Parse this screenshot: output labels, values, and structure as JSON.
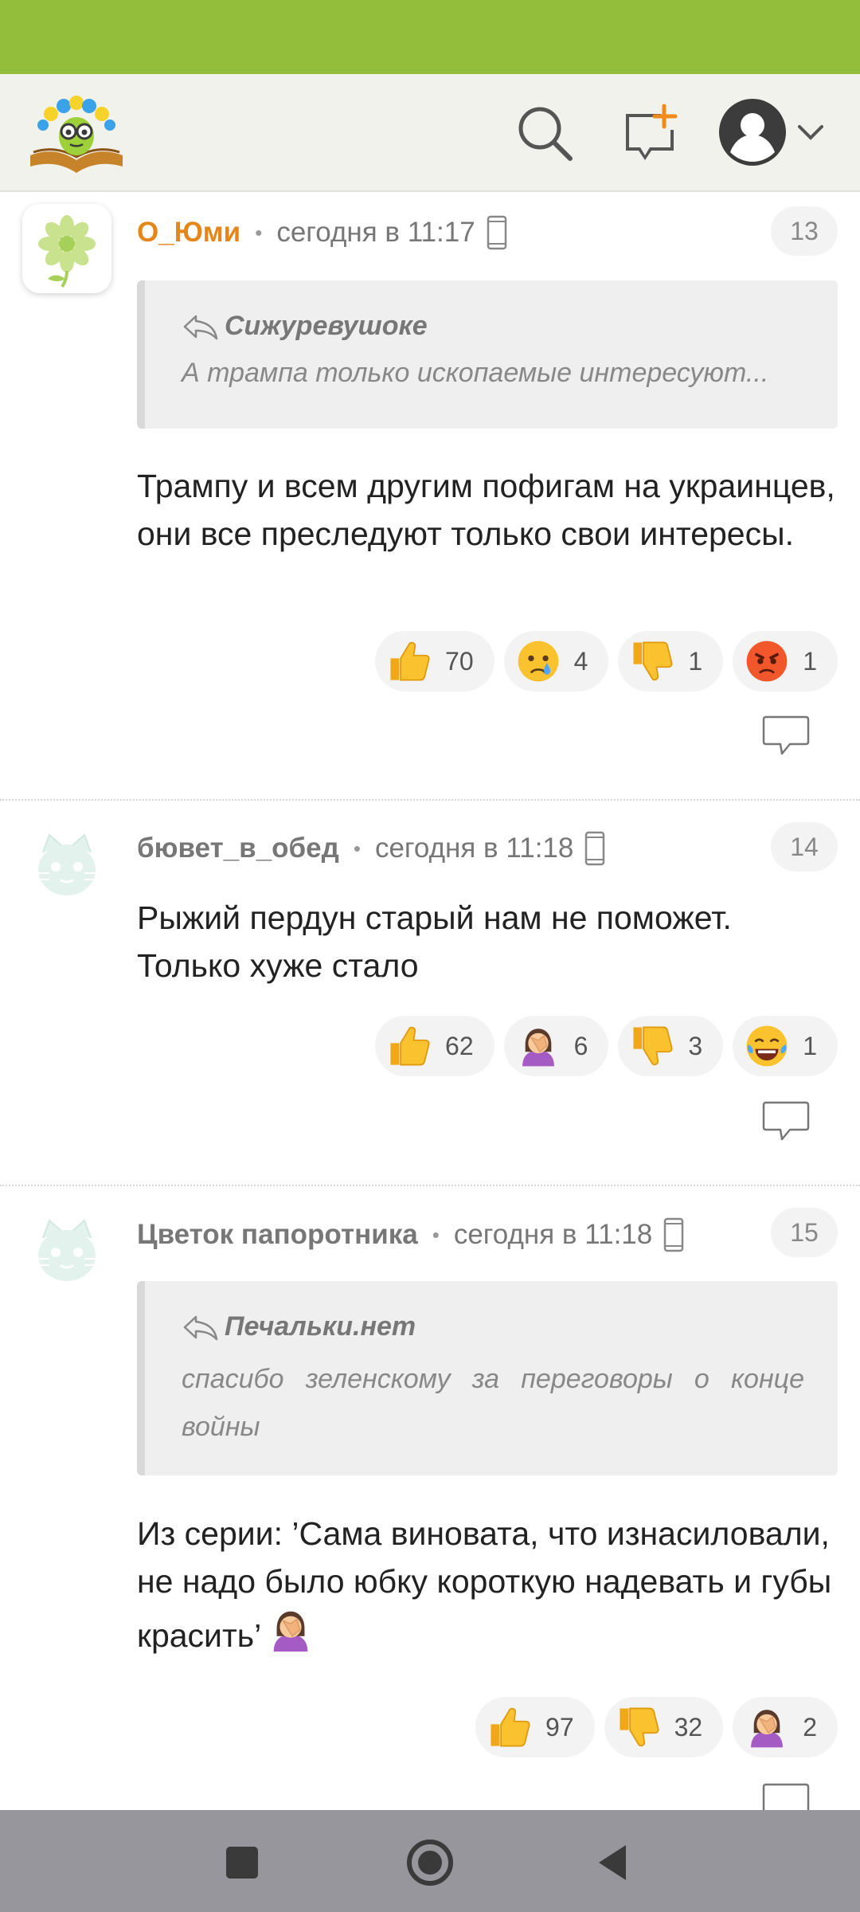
{
  "header": {
    "logo_icon": "smiling-flower-book-logo",
    "search_icon": "search-icon",
    "new_post_icon": "new-post-plus-icon",
    "profile_icon": "user-avatar-icon",
    "menu_icon": "chevron-down-icon"
  },
  "colors": {
    "status_bar": "#93be3c",
    "header_bg": "#f2f2ec",
    "accent_orange": "#e5861b",
    "nav_bar": "#96969c"
  },
  "comments": [
    {
      "author": "О_Юми",
      "time": "сегодня в 11:17",
      "number": "13",
      "quote_author": "Сижуревушоке",
      "quote_text": "А трампа только ископаемые интересуют...",
      "text": "Трампу и всем другим пофигам на украинцев, они все преследуют только свои интересы.",
      "reactions": [
        {
          "icon": "thumbs-up-icon",
          "count": "70"
        },
        {
          "icon": "crying-face-icon",
          "count": "4"
        },
        {
          "icon": "thumbs-down-icon",
          "count": "1"
        },
        {
          "icon": "angry-face-icon",
          "count": "1"
        }
      ]
    },
    {
      "author": "бювет_в_обед",
      "time": "сегодня в 11:18",
      "number": "14",
      "text": "Рыжий пердун старый нам не поможет. Только хуже стало",
      "reactions": [
        {
          "icon": "thumbs-up-icon",
          "count": "62"
        },
        {
          "icon": "facepalm-icon",
          "count": "6"
        },
        {
          "icon": "thumbs-down-icon",
          "count": "3"
        },
        {
          "icon": "laughing-tears-icon",
          "count": "1"
        }
      ]
    },
    {
      "author": "Цветок папоротника",
      "time": "сегодня в 11:18",
      "number": "15",
      "quote_author": "Печальки.нет",
      "quote_text": "спасибо зеленскому за переговоры о конце войны",
      "text": "Из серии: ’Сама виновата, что изнасиловали, не надо было юбку короткую надевать и губы красить’",
      "reactions": [
        {
          "icon": "thumbs-up-icon",
          "count": "97"
        },
        {
          "icon": "thumbs-down-icon",
          "count": "32"
        },
        {
          "icon": "facepalm-icon",
          "count": "2"
        }
      ]
    }
  ],
  "nav": {
    "recents_icon": "square-recents-icon",
    "home_icon": "circle-home-icon",
    "back_icon": "triangle-back-icon"
  }
}
